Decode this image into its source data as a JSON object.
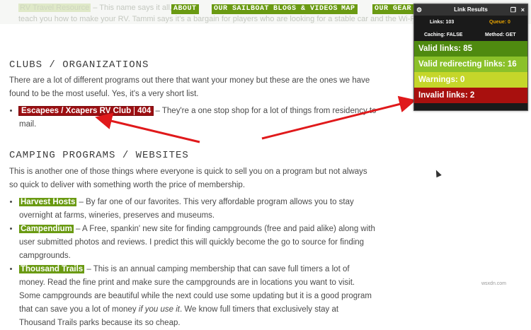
{
  "topbar": {
    "line1_start": "RV Travel Resource",
    "line1_rest": " – This name says it all, these",
    "line2": "teach you how to make your RV. Tammi says it's a bargain for players who are looking for a stable car and the Wi-Fi service.",
    "nav": [
      "ABOUT",
      "OUR SAILBOAT",
      "BLOGS & VIDEOS",
      "MAP",
      "OUR GEAR"
    ]
  },
  "clubs": {
    "heading": "CLUBS / ORGANIZATIONS",
    "intro": "There are a lot of different programs out there that want your money but these are the ones we have found to be the most useful.  Yes, it's a very short list.",
    "items": [
      {
        "link": "Escapees / Xcapers RV Club",
        "status": "404",
        "text": "  –  They're a one stop shop for a lot of things from residency to mail."
      }
    ]
  },
  "camping": {
    "heading": "CAMPING PROGRAMS / WEBSITES",
    "intro": "This is another one of those things where everyone is quick to sell you on a program but not always so quick to deliver with something worth the price of membership.",
    "items": [
      {
        "link": "Harvest Hosts",
        "text": " – By far one of our favorites.  This very affordable program allows you to stay overnight at farms, wineries, preserves and museums."
      },
      {
        "link": "Campendium",
        "text": " – A Free, spankin' new site for finding campgrounds (free and paid alike) along with user submitted photos and reviews.  I predict this will quickly become the go to source for finding campgrounds."
      },
      {
        "link": "Thousand Trails",
        "text_a": "  – This is an annual camping membership that can save full timers a lot of money.  Read the fine print and make sure the campgrounds are in locations you want to visit.  Some campgrounds are beautiful while the next could use some updating but it is a good program that can save you a lot of money ",
        "text_em": "if you use it",
        "text_b": ". We know full timers that exclusively stay at Thousand Trails parks because its so cheap."
      }
    ]
  },
  "panel": {
    "title": "Link Results",
    "links": "Links: 103",
    "queue": "Queue: 0",
    "caching": "Caching: FALSE",
    "method": "Method: GET",
    "valid": "Valid links: 85",
    "redirect": "Valid redirecting links: 16",
    "warnings": "Warnings: 0",
    "invalid": "Invalid links: 2",
    "colors": {
      "valid": "#4f8a10",
      "redirect": "#8bc12a",
      "warnings": "#c5d62a",
      "invalid": "#a8100e"
    }
  },
  "watermark": "wsxdn.com"
}
